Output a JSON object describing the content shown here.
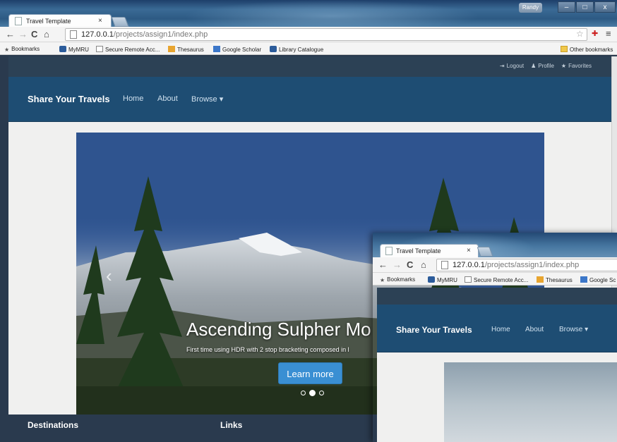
{
  "browser": {
    "tab_title": "Travel Template",
    "tab_close": "×",
    "user_name": "Randy",
    "window_controls": {
      "minimize": "–",
      "maximize": "□",
      "close": "x"
    },
    "url_host": "127.0.0.1",
    "url_path": "/projects/assign1/index.php",
    "bookmarks": [
      {
        "label": "Bookmarks",
        "icon": "star-icon"
      },
      {
        "label": "MyMRU",
        "icon": "mru-icon"
      },
      {
        "label": "Secure Remote Acc...",
        "icon": "page-icon"
      },
      {
        "label": "Thesaurus",
        "icon": "thesaurus-icon"
      },
      {
        "label": "Google Scholar",
        "icon": "scholar-icon"
      },
      {
        "label": "Library Catalogue",
        "icon": "mru-icon"
      }
    ],
    "other_bookmarks": "Other bookmarks"
  },
  "site": {
    "top_links": {
      "logout": "Logout",
      "profile": "Profile",
      "favorites": "Favorites"
    },
    "brand": "Share Your Travels",
    "nav": {
      "home": "Home",
      "about": "About",
      "browse": "Browse ▾"
    },
    "carousel": {
      "title": "Ascending Sulpher Mo",
      "subtitle": "First time using HDR with 2 stop bracketing composed in l",
      "button": "Learn more",
      "prev_arrow": "‹",
      "active_slide": 2,
      "slide_count": 3
    },
    "footer": {
      "destinations": "Destinations",
      "links": "Links"
    }
  },
  "second_window": {
    "tab_title": "Travel Template",
    "tab_close": "×",
    "url_host": "127.0.0.1",
    "url_path": "/projects/assign1/index.php",
    "bookmarks": [
      {
        "label": "Bookmarks"
      },
      {
        "label": "MyMRU"
      },
      {
        "label": "Secure Remote Acc..."
      },
      {
        "label": "Thesaurus"
      },
      {
        "label": "Google Sc"
      }
    ],
    "brand": "Share Your Travels",
    "nav": {
      "home": "Home",
      "about": "About",
      "browse": "Browse ▾"
    }
  },
  "colors": {
    "navbar": "#1e4d73",
    "topstrip": "#2c4155",
    "button": "#3a8fd3",
    "footer": "#2a3a4e"
  }
}
